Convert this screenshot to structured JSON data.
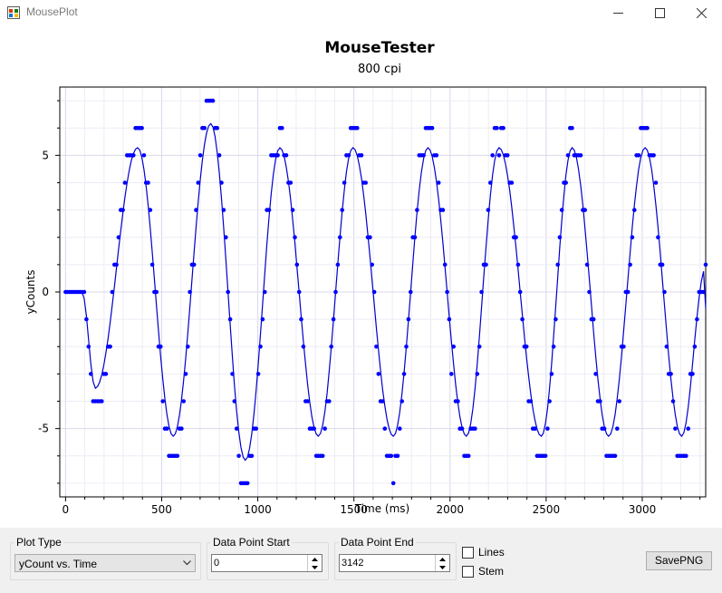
{
  "window": {
    "title": "MousePlot",
    "controls": [
      "minimize-icon",
      "maximize-icon",
      "close-icon"
    ]
  },
  "chart_data": {
    "type": "scatter",
    "title": "MouseTester",
    "subtitle": "800 cpi",
    "xlabel": "Time (ms)",
    "ylabel": "yCounts",
    "xlim": [
      -30,
      3330
    ],
    "ylim": [
      -7.5,
      7.5
    ],
    "xticks": [
      0,
      500,
      1000,
      1500,
      2000,
      2500,
      3000
    ],
    "yticks": [
      -5,
      0,
      5
    ],
    "grid": true,
    "colors": {
      "marker": "#0000ff",
      "line": "#0000cd",
      "grid": "#d8d8ec",
      "minor_grid": "#ececf6"
    },
    "series": [
      {
        "kind": "points",
        "approx_points": 300,
        "pattern": "sinusoid of yCount vs time, amplitude ~6 counts, period ~380 ms, 8 cycles between 0 and 3300 ms",
        "extremes": [
          {
            "x": 0,
            "y": 0
          },
          {
            "x": 85,
            "y": 0
          },
          {
            "x": 155,
            "y": -4
          },
          {
            "x": 375,
            "y": 6
          },
          {
            "x": 560,
            "y": -6
          },
          {
            "x": 755,
            "y": 7
          },
          {
            "x": 935,
            "y": -7
          },
          {
            "x": 1115,
            "y": 6
          },
          {
            "x": 1315,
            "y": -6
          },
          {
            "x": 1495,
            "y": 6
          },
          {
            "x": 1705,
            "y": -6
          },
          {
            "x": 1885,
            "y": 6
          },
          {
            "x": 2085,
            "y": -6
          },
          {
            "x": 2255,
            "y": 6
          },
          {
            "x": 2475,
            "y": -6
          },
          {
            "x": 2635,
            "y": 6
          },
          {
            "x": 2825,
            "y": -6
          },
          {
            "x": 3015,
            "y": 6
          },
          {
            "x": 3205,
            "y": -6
          },
          {
            "x": 3330,
            "y": 1
          }
        ]
      },
      {
        "kind": "line",
        "pattern": "smoothed running average through the points, amplitude ~5.3"
      }
    ]
  },
  "controls": {
    "plot_type": {
      "label": "Plot Type",
      "value": "yCount vs. Time"
    },
    "start": {
      "label": "Data Point Start",
      "value": "0"
    },
    "end": {
      "label": "Data Point End",
      "value": "3142"
    },
    "lines": {
      "label": "Lines",
      "checked": false
    },
    "stem": {
      "label": "Stem",
      "checked": false
    },
    "save": {
      "label": "SavePNG"
    }
  }
}
